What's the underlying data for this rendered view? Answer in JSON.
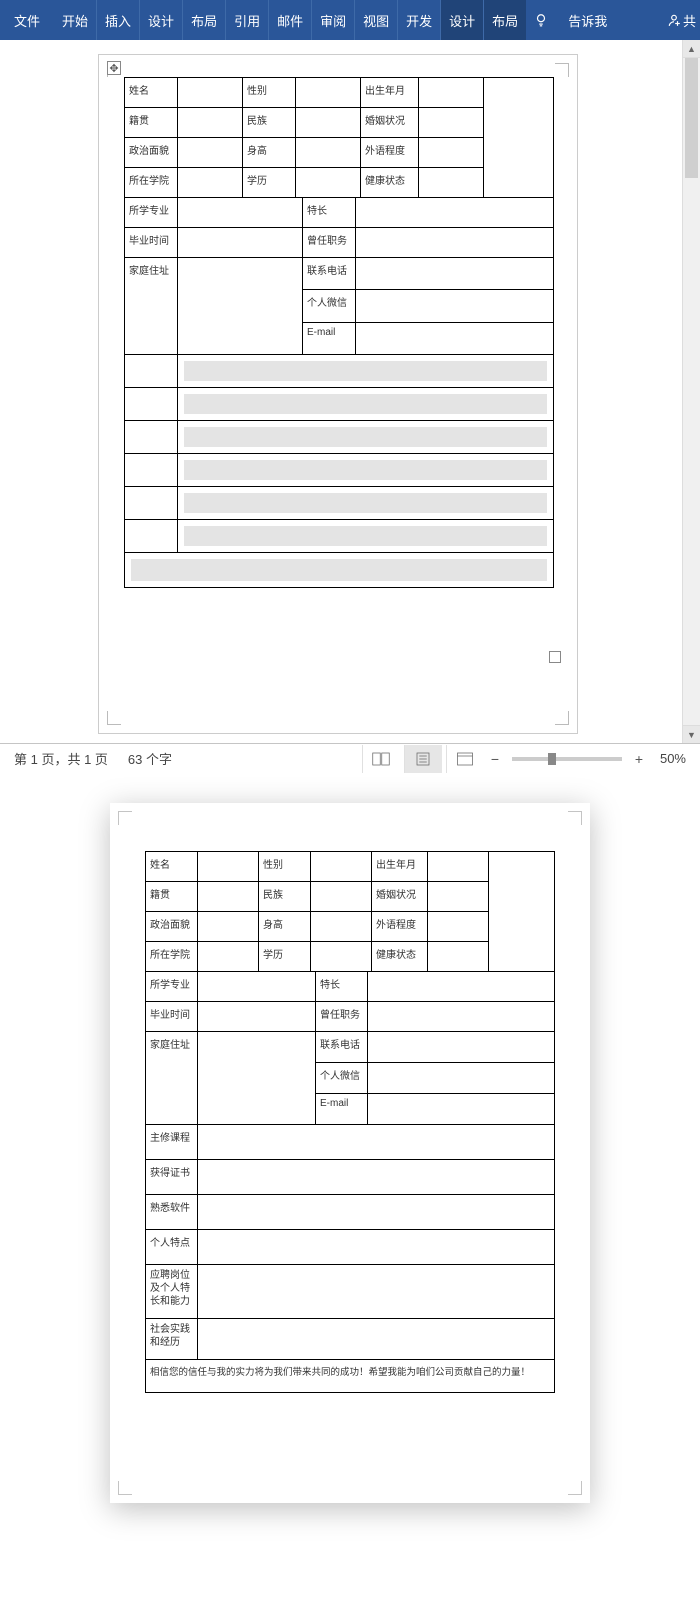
{
  "ribbon": {
    "tabs": [
      "文件",
      "开始",
      "插入",
      "设计",
      "布局",
      "引用",
      "邮件",
      "审阅",
      "视图",
      "开发",
      "设计",
      "布局"
    ],
    "tell_me": "告诉我",
    "share_glyph": "共"
  },
  "statusbar": {
    "page_info": "第 1 页，共 1 页",
    "word_count": "63 个字",
    "zoom": "50%"
  },
  "form": {
    "r1": {
      "c1": "姓名",
      "c2": "性别",
      "c3": "出生年月"
    },
    "r2": {
      "c1": "籍贯",
      "c2": "民族",
      "c3": "婚姻状况"
    },
    "r3": {
      "c1": "政治面貌",
      "c2": "身高",
      "c3": "外语程度"
    },
    "r4": {
      "c1": "所在学院",
      "c2": "学历",
      "c3": "健康状态"
    },
    "r5": {
      "c1": "所学专业",
      "c2": "特长"
    },
    "r6": {
      "c1": "毕业时间",
      "c2": "曾任职务"
    },
    "r7": {
      "c1": "家庭住址",
      "c2": "联系电话",
      "c3": "个人微信",
      "c4": "E-mail"
    },
    "r8": "主修课程",
    "r9": "获得证书",
    "r10": "熟悉软件",
    "r11": "个人特点",
    "r12a": "应聘岗位",
    "r12b": "及个人特",
    "r12c": "长和能力",
    "r13a": "社会实践",
    "r13b": "和经历",
    "footer": "相信您的信任与我的实力将为我们带来共同的成功！希望我能为咱们公司贡献自己的力量！"
  }
}
